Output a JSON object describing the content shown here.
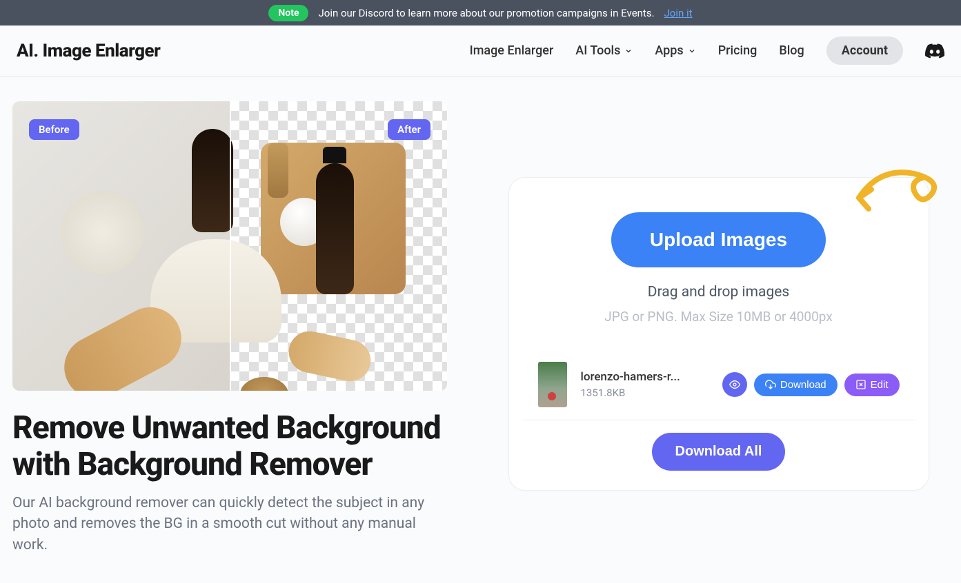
{
  "noteBar": {
    "badge": "Note",
    "text": "Join our Discord to learn more about our promotion campaigns in Events.",
    "link": "Join it"
  },
  "header": {
    "logo": "AI. Image Enlarger",
    "nav": {
      "enlarger": "Image Enlarger",
      "aiTools": "AI Tools",
      "apps": "Apps",
      "pricing": "Pricing",
      "blog": "Blog",
      "account": "Account"
    }
  },
  "compare": {
    "before": "Before",
    "after": "After"
  },
  "hero": {
    "title": "Remove Unwanted Background with Background Remover",
    "desc": "Our AI background remover can quickly detect the subject in any photo and removes the BG in a smooth cut without any manual work."
  },
  "upload": {
    "button": "Upload Images",
    "dragText": "Drag and drop images",
    "specText": "JPG or PNG. Max Size 10MB or 4000px",
    "file": {
      "name": "lorenzo-hamers-r...",
      "size": "1351.8KB"
    },
    "actions": {
      "download": "Download",
      "edit": "Edit"
    },
    "downloadAll": "Download All"
  }
}
